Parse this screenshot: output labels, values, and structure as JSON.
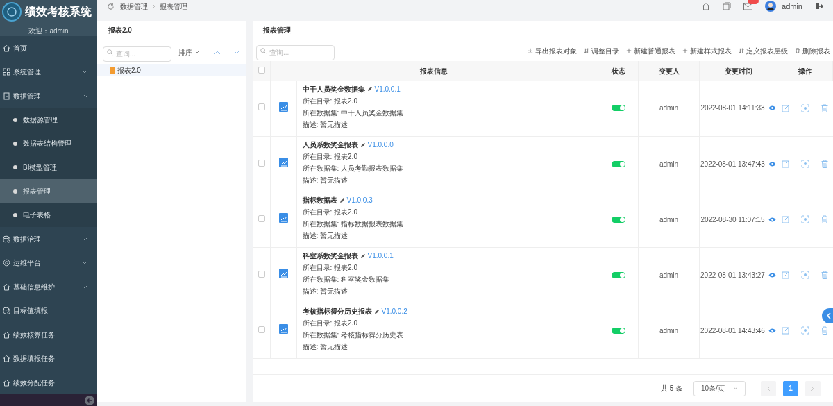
{
  "app": {
    "title": "绩效考核系统",
    "welcome": "欢迎：admin"
  },
  "sidebar": {
    "items": [
      {
        "label": "首页",
        "kind": "link"
      },
      {
        "label": "系统管理",
        "kind": "group",
        "expanded": false
      },
      {
        "label": "数据管理",
        "kind": "group",
        "expanded": true,
        "children": [
          {
            "label": "数据源管理",
            "selected": false
          },
          {
            "label": "数据表结构管理",
            "selected": false
          },
          {
            "label": "BI模型管理",
            "selected": false
          },
          {
            "label": "报表管理",
            "selected": true
          },
          {
            "label": "电子表格",
            "selected": false
          }
        ]
      },
      {
        "label": "数据治理",
        "kind": "group",
        "expanded": false
      },
      {
        "label": "运维平台",
        "kind": "group",
        "expanded": false
      },
      {
        "label": "基础信息维护",
        "kind": "group",
        "expanded": false
      },
      {
        "label": "目标值填报",
        "kind": "link"
      },
      {
        "label": "绩效核算任务",
        "kind": "link"
      },
      {
        "label": "数据填报任务",
        "kind": "link"
      },
      {
        "label": "绩效分配任务",
        "kind": "link"
      }
    ]
  },
  "breadcrumb": [
    "数据管理",
    "报表管理"
  ],
  "header": {
    "user": "admin"
  },
  "tree_panel": {
    "title": "报表2.0",
    "search": {
      "placeholder": "查询..."
    },
    "sort": "排序",
    "items": [
      {
        "label": "报表2.0",
        "selected": true
      }
    ]
  },
  "main": {
    "title": "报表管理",
    "search": {
      "placeholder": "查询..."
    },
    "actions": [
      "导出报表对象",
      "调整目录",
      "新建普通报表",
      "新建样式报表",
      "定义报表层级",
      "删除报表"
    ],
    "table": {
      "all_checked": false,
      "columns": [
        "报表信息",
        "状态",
        "变更人",
        "变更时间",
        "操作"
      ],
      "rows": [
        {
          "checked": false,
          "name": "中干人员奖金数据集",
          "version": "V1.0.0.1",
          "dir": "所在目录: 报表2.0",
          "dataset": "所在数据集: 中干人员奖金数据集",
          "desc": "描述: 暂无描述",
          "on": true,
          "user": "admin",
          "time": "2022-08-01 14:11:33"
        },
        {
          "checked": false,
          "name": "人员系数奖金报表",
          "version": "V1.0.0.0",
          "dir": "所在目录: 报表2.0",
          "dataset": "所在数据集: 人员考勤报表数据集",
          "desc": "描述: 暂无描述",
          "on": true,
          "user": "admin",
          "time": "2022-08-01 13:47:43"
        },
        {
          "checked": false,
          "name": "指标数据表",
          "version": "V1.0.0.3",
          "dir": "所在目录: 报表2.0",
          "dataset": "所在数据集: 指标数据报表数据集",
          "desc": "描述: 暂无描述",
          "on": true,
          "user": "admin",
          "time": "2022-08-30 11:07:15"
        },
        {
          "checked": false,
          "name": "科室系数奖金报表",
          "version": "V1.0.0.1",
          "dir": "所在目录: 报表2.0",
          "dataset": "所在数据集: 科室奖金数据集",
          "desc": "描述: 暂无描述",
          "on": true,
          "user": "admin",
          "time": "2022-08-01 13:43:27"
        },
        {
          "checked": false,
          "name": "考核指标得分历史报表",
          "version": "V1.0.0.2",
          "dir": "所在目录: 报表2.0",
          "dataset": "所在数据集: 考核指标得分历史表",
          "desc": "描述: 暂无描述",
          "on": true,
          "user": "admin",
          "time": "2022-08-01 14:43:46"
        }
      ]
    },
    "pagination": {
      "total": "共 5 条",
      "page_size": "10条/页",
      "pages": [
        {
          "label": "1",
          "selected": true
        }
      ]
    }
  }
}
